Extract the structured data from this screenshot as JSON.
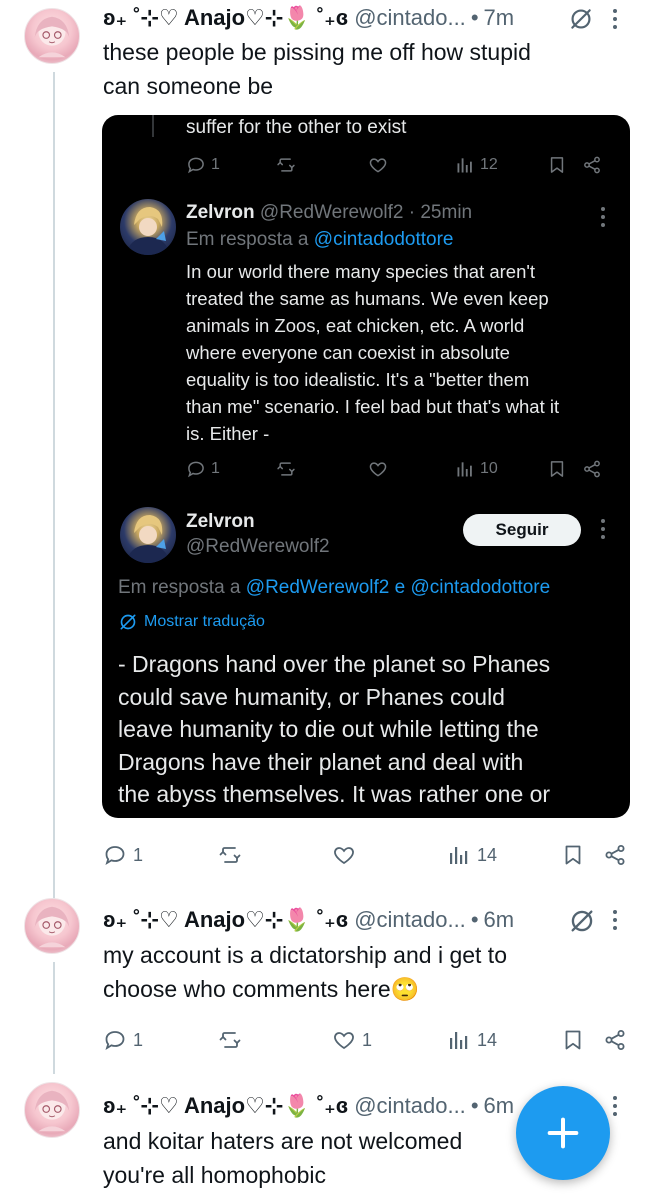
{
  "tweets": [
    {
      "display_name": "ʚ₊ ˚⊹♡ Anajo♡⊹🌷 ˚₊ɞ",
      "handle": "@cintado...",
      "time": "7m",
      "text": "these people be pissing me off how stupid\ncan someone be",
      "actions": {
        "replies": "1",
        "retweets": "",
        "likes": "",
        "views": "14"
      }
    },
    {
      "display_name": "ʚ₊ ˚⊹♡ Anajo♡⊹🌷 ˚₊ɞ",
      "handle": "@cintado...",
      "time": "6m",
      "text": "my account is a dictatorship and i get to\nchoose who comments here🙄",
      "actions": {
        "replies": "1",
        "retweets": "",
        "likes": "1",
        "views": "14"
      }
    },
    {
      "display_name": "ʚ₊ ˚⊹♡ Anajo♡⊹🌷 ˚₊ɞ",
      "handle": "@cintado...",
      "time": "6m",
      "text": "and koitar haters are not welcomed\nyou're all homophobic"
    }
  ],
  "screenshot": {
    "top_text": "suffer for the other to exist",
    "top_actions": {
      "replies": "1",
      "views": "12"
    },
    "reply": {
      "name": "Zelvron",
      "handle": "@RedWerewolf2",
      "time": "· 25min",
      "replying_prefix": "Em resposta a",
      "replying_to": "@cintadodottore",
      "lines": [
        "In our world there many species that aren't",
        "treated the same as humans. We even keep",
        "animals in Zoos, eat chicken, etc. A world",
        "where everyone can coexist in absolute",
        "equality is too idealistic. It's a \"better them",
        "than me\" scenario. I feel bad but that's what it",
        "is. Either -"
      ],
      "actions": {
        "replies": "1",
        "views": "10"
      }
    },
    "main": {
      "name": "Zelvron",
      "handle": "@RedWerewolf2",
      "follow_label": "Seguir",
      "replying_prefix": "Em resposta a",
      "replying_to_1": "@RedWerewolf2",
      "replying_joiner": "e",
      "replying_to_2": "@cintadodottore",
      "translate_label": "Mostrar tradução",
      "lines": [
        "- Dragons hand over the planet so Phanes",
        "could save humanity, or Phanes could",
        "leave humanity to die out while letting the",
        "Dragons have their planet and deal with",
        "the abyss themselves. It was rather one or"
      ]
    }
  },
  "colors": {
    "accent": "#1d9bf0",
    "text": "#0f1419",
    "muted": "#536471",
    "dark_bg": "#000000"
  },
  "icons": [
    "reply-icon",
    "retweet-icon",
    "like-icon",
    "views-icon",
    "bookmark-icon",
    "share-icon",
    "grok-icon",
    "compose-icon"
  ]
}
